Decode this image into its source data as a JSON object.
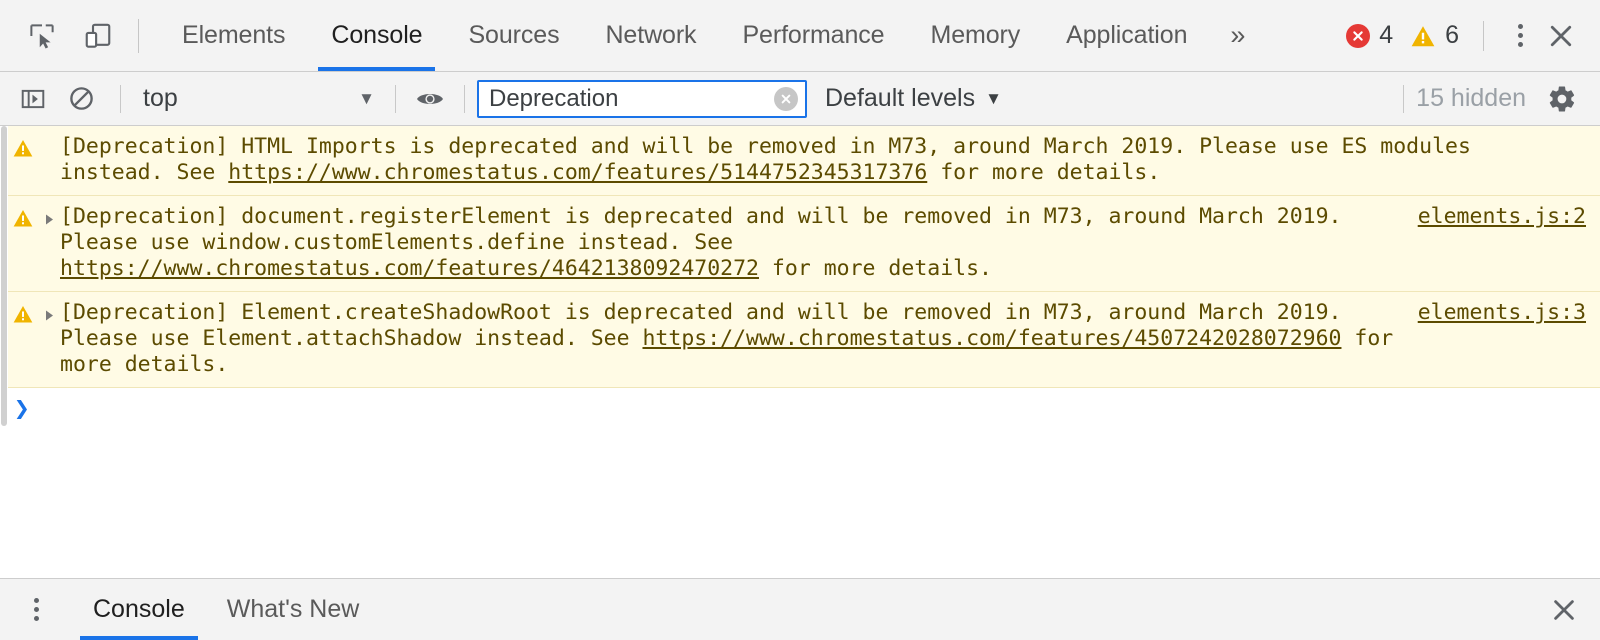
{
  "window": {
    "app": "Chrome DevTools"
  },
  "toolbar": {
    "inspect_icon": "inspect-cursor-icon",
    "device_icon": "device-toggle-icon",
    "tabs": [
      {
        "label": "Elements",
        "selected": false
      },
      {
        "label": "Console",
        "selected": true
      },
      {
        "label": "Sources",
        "selected": false
      },
      {
        "label": "Network",
        "selected": false
      },
      {
        "label": "Performance",
        "selected": false
      },
      {
        "label": "Memory",
        "selected": false
      },
      {
        "label": "Application",
        "selected": false
      }
    ],
    "more_tabs_label": "»",
    "error_count": "4",
    "warning_count": "6",
    "error_color": "#e53935",
    "warning_color": "#f0ae1a",
    "accent_color": "#1a73e8",
    "main_menu_icon": "vertical-dots-icon",
    "close_icon": "close-icon"
  },
  "filterbar": {
    "sidebar_toggle_icon": "console-sidebar-icon",
    "clear_console_icon": "clear-console-icon",
    "context": {
      "selected": "top",
      "caret": "▼"
    },
    "live_expression_icon": "eye-icon",
    "filter": {
      "value": "Deprecation",
      "placeholder": "Filter",
      "clear_icon": "clear-filter-icon"
    },
    "levels": {
      "label": "Default levels",
      "caret": "▼"
    },
    "hidden_count": "15 hidden",
    "settings_icon": "gear-icon"
  },
  "console": {
    "messages": [
      {
        "level": "warning",
        "icon": "warning-triangle-icon",
        "expandable": false,
        "text_before": "[Deprecation] HTML Imports is deprecated and will be removed in M73, around March 2019. Please use ES modules instead. See ",
        "link": "https://www.chromestatus.com/features/5144752345317376",
        "text_after": " for more details.",
        "source": ""
      },
      {
        "level": "warning",
        "icon": "warning-triangle-icon",
        "expandable": true,
        "expand_icon": "expand-triangle-icon",
        "text_before": "[Deprecation] document.registerElement is deprecated and will be removed in M73, around March 2019. Please use window.customElements.define instead. See ",
        "link": "https://www.chromestatus.com/features/4642138092470272",
        "text_after": " for more details.",
        "source": "elements.js:2"
      },
      {
        "level": "warning",
        "icon": "warning-triangle-icon",
        "expandable": true,
        "expand_icon": "expand-triangle-icon",
        "text_before": "[Deprecation] Element.createShadowRoot is deprecated and will be removed in M73, around March 2019. Please use Element.attachShadow instead. See ",
        "link": "https://www.chromestatus.com/features/4507242028072960",
        "text_after": " for more details.",
        "source": "elements.js:3"
      }
    ],
    "prompt": {
      "caret": "❯",
      "value": "",
      "placeholder": ""
    }
  },
  "drawer": {
    "menu_icon": "vertical-dots-icon",
    "tabs": [
      {
        "label": "Console",
        "selected": true
      },
      {
        "label": "What's New",
        "selected": false
      }
    ],
    "close_icon": "close-icon"
  }
}
